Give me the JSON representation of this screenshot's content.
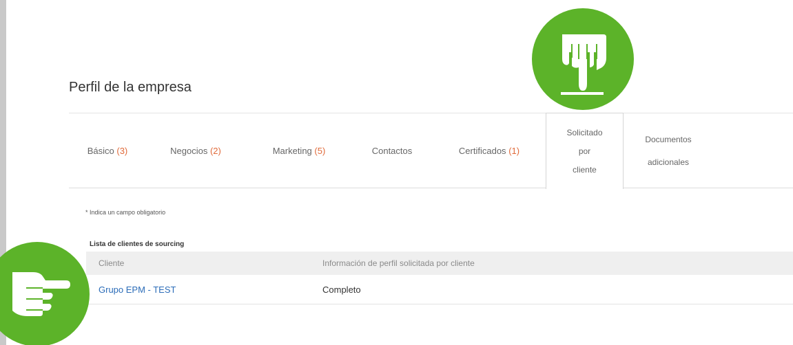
{
  "page": {
    "title": "Perfil de la empresa"
  },
  "tabs": [
    {
      "label": "Básico",
      "count": "(3)",
      "active": false
    },
    {
      "label": "Negocios",
      "count": "(2)",
      "active": false
    },
    {
      "label": "Marketing",
      "count": "(5)",
      "active": false
    },
    {
      "label": "Contactos",
      "count": "",
      "active": false
    },
    {
      "label": "Certificados",
      "count": "(1)",
      "active": false
    },
    {
      "label_lines": [
        "Solicitado",
        "por",
        "cliente"
      ],
      "active": true
    },
    {
      "label_lines": [
        "Documentos",
        "adicionales"
      ],
      "active": false
    }
  ],
  "form": {
    "required_note": "* Indica un campo obligatorio"
  },
  "client_list": {
    "title": "Lista de clientes de sourcing",
    "columns": [
      "Cliente",
      "Información de perfil solicitada por cliente"
    ],
    "rows": [
      {
        "client": "Grupo EPM - TEST",
        "status": "Completo"
      }
    ]
  },
  "callouts": {
    "color": "#5cb329",
    "top_icon": "pointing-down-hand-icon",
    "left_icon": "pointing-right-hand-icon"
  }
}
